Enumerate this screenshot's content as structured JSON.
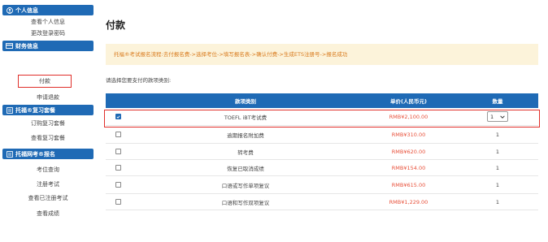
{
  "sidebar": {
    "sections": [
      {
        "title": "个人信息",
        "icon": "user-circle-icon",
        "items": [
          "查看个人信息",
          "更改登录密码"
        ]
      },
      {
        "title": "财务信息",
        "icon": "card-icon",
        "items": [
          "付款",
          "申请退款"
        ]
      },
      {
        "title": "托福®复习套餐",
        "icon": "book-icon",
        "items": [
          "订购复习套餐",
          "查看复习套餐"
        ]
      },
      {
        "title": "托福网考®报名",
        "icon": "book-icon",
        "items": [
          "考位查询",
          "注册考试",
          "查看已注册考试",
          "查看成绩"
        ]
      }
    ],
    "active_item": "付款"
  },
  "main": {
    "title": "付款",
    "notice": "托福®考试报名流程:去付报名费->选择考位->填写报名表->确认付费->生成ETS注册号->报名成功",
    "prompt": "请选择您要支付的款项类别:",
    "table": {
      "headers": [
        "款项类别",
        "单价(人民币元)",
        "数量"
      ],
      "rows": [
        {
          "checked": true,
          "name": "TOEFL iBT考试费",
          "price": "RMB¥2,100.00",
          "qty": "1",
          "qty_select": true
        },
        {
          "checked": false,
          "name": "逾期报名附加费",
          "price": "RMB¥310.00",
          "qty": "1",
          "qty_select": false
        },
        {
          "checked": false,
          "name": "转考费",
          "price": "RMB¥620.00",
          "qty": "1",
          "qty_select": false
        },
        {
          "checked": false,
          "name": "恢复已取消成绩",
          "price": "RMB¥154.00",
          "qty": "1",
          "qty_select": false
        },
        {
          "checked": false,
          "name": "口语或写作单项复议",
          "price": "RMB¥615.00",
          "qty": "1",
          "qty_select": false
        },
        {
          "checked": false,
          "name": "口语和写作双项复议",
          "price": "RMB¥1,229.00",
          "qty": "1",
          "qty_select": false
        }
      ]
    }
  },
  "colors": {
    "brand_blue": "#1f6ab5",
    "price_red": "#e8503a",
    "highlight_red": "#e0302b",
    "notice_bg": "#fcf3da",
    "notice_text": "#d87a1c"
  }
}
